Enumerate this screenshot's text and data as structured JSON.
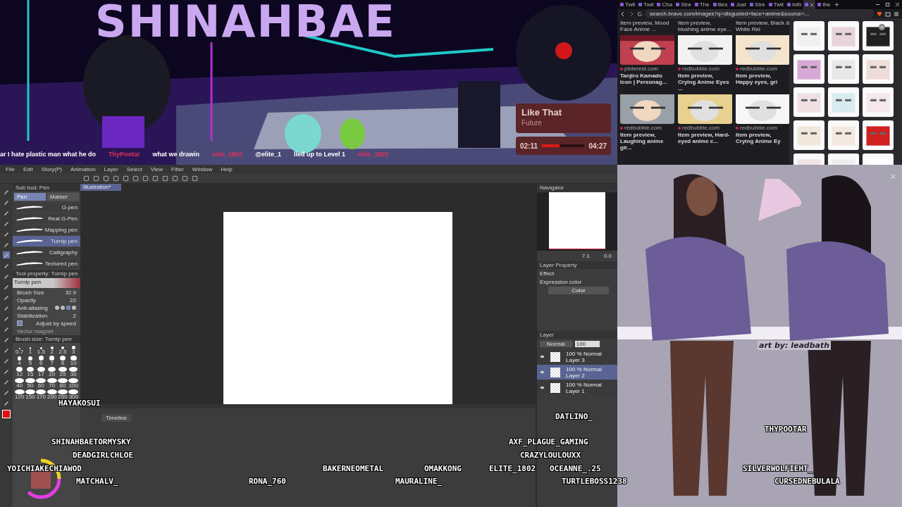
{
  "stream_banner": {
    "title": "SHINAHBAE",
    "chat_ticker": [
      {
        "kind": "message",
        "text": "ar I hate plastic man what he do"
      },
      {
        "kind": "user",
        "text": "ThyPootar"
      },
      {
        "kind": "message",
        "text": "what we drawin"
      },
      {
        "kind": "user",
        "text": "elite_1802"
      },
      {
        "kind": "message",
        "text": "@elite_1"
      },
      {
        "kind": "message",
        "text": "lled up to Level 1"
      },
      {
        "kind": "user",
        "text": "elite_1802"
      }
    ],
    "now_playing": {
      "song": "Like That",
      "artist": "Future",
      "elapsed": "02:11",
      "total": "04:27",
      "level": 0.42
    }
  },
  "browser": {
    "tabs": [
      {
        "label": "Twit",
        "selected": false
      },
      {
        "label": "Twit",
        "selected": false
      },
      {
        "label": "Cha",
        "selected": false
      },
      {
        "label": "Stre",
        "selected": false
      },
      {
        "label": "The",
        "selected": false
      },
      {
        "label": "Bes",
        "selected": false
      },
      {
        "label": "Just",
        "selected": false
      },
      {
        "label": "Stre",
        "selected": false
      },
      {
        "label": "Twit",
        "selected": false
      },
      {
        "label": "Inth",
        "selected": false
      },
      {
        "selected": true
      },
      {
        "label": "the",
        "selected": false
      }
    ],
    "url": "search.brave.com/images?q=disgusted+face+anime&source=...",
    "top_captions": [
      "Item preview, Mood Face Anime ...",
      "Item preview, blushing anime eye...",
      "Item preview, Black & White Rel"
    ],
    "results": [
      {
        "source": "pinterest.com",
        "caption": "Tanjiro Kamado Icon | Personag..."
      },
      {
        "source": "redbubble.com",
        "caption": "Item preview, Crying Anime Eyes ..."
      },
      {
        "source": "redbubble.com",
        "caption": "Item preview, Happy eyes, gri"
      },
      {
        "source": "redbubble.com",
        "caption": "Item preview, Laughing anime gir..."
      },
      {
        "source": "redbubble.com",
        "caption": "Item preview, Hard-eyed anime c..."
      },
      {
        "source": "redbubble.com",
        "caption": "Item preview, Crying Anime Ey"
      }
    ]
  },
  "paint_app": {
    "menu": [
      "File",
      "Edit",
      "Story(P)",
      "Animation",
      "Layer",
      "Select",
      "View",
      "Filter",
      "Window",
      "Help"
    ],
    "sub_tool_title": "Sub tool: Pen",
    "sub_tool_tabs": [
      {
        "label": "Pen",
        "selected": true
      },
      {
        "label": "Marker",
        "selected": false
      }
    ],
    "brushes": [
      {
        "name": "G-pen",
        "selected": false
      },
      {
        "name": "Real G-Pen",
        "selected": false
      },
      {
        "name": "Mapping pen",
        "selected": false
      },
      {
        "name": "Turnip pen",
        "selected": true
      },
      {
        "name": "Calligraphy",
        "selected": false
      },
      {
        "name": "Textured pen",
        "selected": false
      }
    ],
    "tool_property": {
      "title": "Tool property: Turnip pen",
      "preview_label": "Turnip pen",
      "brush_size": "32.9",
      "opacity": "22",
      "anti_aliasing": "Anti-aliasing",
      "anti_aliasing_options": [
        {
          "selected": false
        },
        {
          "selected": false
        },
        {
          "selected": true
        },
        {
          "selected": false
        }
      ],
      "stabilization": "2",
      "adjust_by_speed": {
        "label": "Adjust by speed",
        "checked": true
      },
      "vector_magnet": {
        "label": "Vector magnet",
        "disabled": true
      },
      "labels": [
        "Brush Size",
        "Opacity",
        "Stabilization"
      ]
    },
    "brush_size_title": "Brush size: Turnip pen",
    "brush_sizes": [
      "0.7",
      "1",
      "1.5",
      "2",
      "2.5",
      "3",
      "4",
      "5",
      "6",
      "7",
      "8",
      "10",
      "12",
      "15",
      "17",
      "20",
      "25",
      "30",
      "40",
      "50",
      "60",
      "70",
      "80",
      "100",
      "120",
      "150",
      "170",
      "200",
      "250",
      "300"
    ],
    "canvas_tab": "Illustration*",
    "timeline_title": "Timeline",
    "navigator": {
      "title": "Navigator",
      "zoom": "7.1",
      "angle": "0.0"
    },
    "layer_property": {
      "title": "Layer Property",
      "effect": "Effect",
      "expression_label": "Expression color",
      "expression_value": "Color"
    },
    "layer_panel": {
      "title": "Layer",
      "blend": "Normal",
      "opacity": "100",
      "layers": [
        {
          "mode": "100 % Normal",
          "name": "Layer 3",
          "selected": false
        },
        {
          "mode": "100 % Normal",
          "name": "Layer 2",
          "selected": true
        },
        {
          "mode": "100 % Normal",
          "name": "Layer 1",
          "selected": false
        }
      ]
    }
  },
  "reference_art": {
    "credit": "art by: leadbath"
  },
  "viewer_names": [
    "HAYAKOSUI",
    "DATLINO_",
    "THYPOOTAR",
    "SHINAHBAETORMYSKY",
    "AXF_PLAGUE_GAMING",
    "DEADGIRLCHLOE",
    "CRAZYLOULOUXX",
    "YOICHIAKECHIAWOD",
    "BAKERNEOMETAL",
    "OMAKKONG",
    "ELITE_1802",
    "OCEANNE_.25",
    "SILVERWOLFIEHT_",
    "MATCHALV_",
    "RONA_760",
    "MAURALINE_",
    "TURTLEBOSS1238",
    "CURSEDNEBULALA"
  ]
}
